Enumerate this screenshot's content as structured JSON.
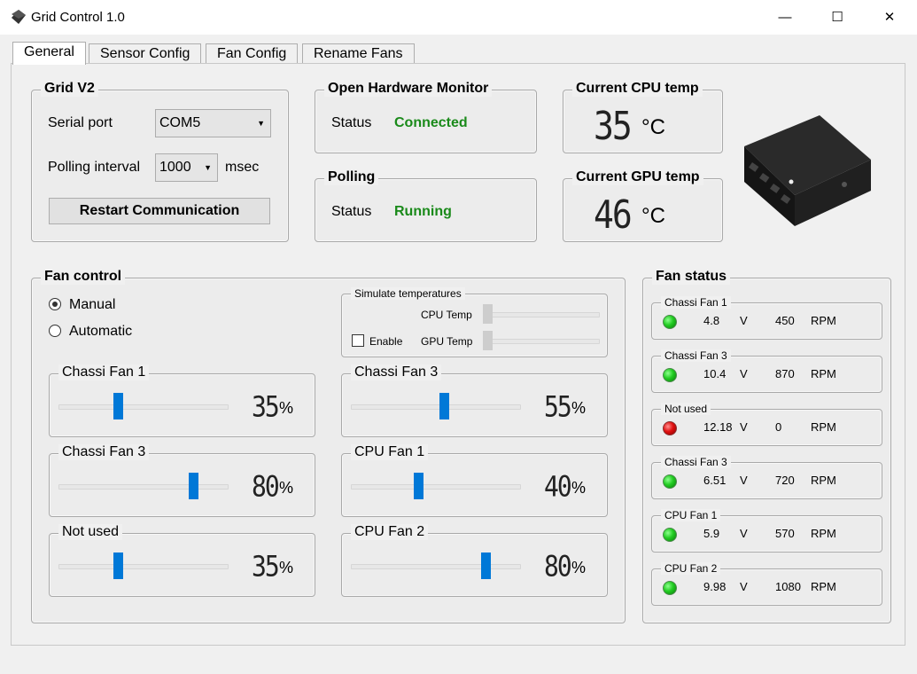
{
  "window": {
    "title": "Grid Control 1.0",
    "icon": "grid-device-icon",
    "minimize_glyph": "—",
    "maximize_glyph": "☐",
    "close_glyph": "✕"
  },
  "tabs": [
    {
      "label": "General",
      "selected": true
    },
    {
      "label": "Sensor Config",
      "selected": false
    },
    {
      "label": "Fan Config",
      "selected": false
    },
    {
      "label": "Rename Fans",
      "selected": false
    }
  ],
  "grid": {
    "title": "Grid V2",
    "serial_port_label": "Serial port",
    "serial_port_value": "COM5",
    "polling_interval_label": "Polling interval",
    "polling_interval_value": "1000",
    "polling_unit": "msec",
    "restart_button": "Restart Communication"
  },
  "ohm": {
    "title": "Open Hardware Monitor",
    "status_label": "Status",
    "status_value": "Connected"
  },
  "polling": {
    "title": "Polling",
    "status_label": "Status",
    "status_value": "Running"
  },
  "cpu_temp": {
    "title": "Current CPU temp",
    "value": "35",
    "unit": "°C"
  },
  "gpu_temp": {
    "title": "Current GPU temp",
    "value": "46",
    "unit": "°C"
  },
  "fan_control": {
    "title": "Fan control",
    "mode_manual": "Manual",
    "mode_automatic": "Automatic",
    "selected_mode": "Manual",
    "simulate": {
      "title": "Simulate temperatures",
      "cpu_label": "CPU Temp",
      "gpu_label": "GPU Temp",
      "enable_label": "Enable",
      "enabled": false
    },
    "fans": [
      {
        "name": "Chassi Fan 1",
        "value": "35",
        "unit": "%",
        "level": 0.35
      },
      {
        "name": "Chassi Fan 3",
        "value": "55",
        "unit": "%",
        "level": 0.55
      },
      {
        "name": "Chassi Fan 3",
        "value": "80",
        "unit": "%",
        "level": 0.8
      },
      {
        "name": "CPU Fan 1",
        "value": "40",
        "unit": "%",
        "level": 0.4
      },
      {
        "name": "Not used",
        "value": "35",
        "unit": "%",
        "level": 0.35
      },
      {
        "name": "CPU Fan 2",
        "value": "80",
        "unit": "%",
        "level": 0.8
      }
    ]
  },
  "fan_status": {
    "title": "Fan status",
    "voltage_unit": "V",
    "rpm_unit": "RPM",
    "items": [
      {
        "name": "Chassi Fan 1",
        "voltage": "4.8",
        "rpm": "450",
        "led": "green"
      },
      {
        "name": "Chassi Fan 3",
        "voltage": "10.4",
        "rpm": "870",
        "led": "green"
      },
      {
        "name": "Not used",
        "voltage": "12.18",
        "rpm": "0",
        "led": "red"
      },
      {
        "name": "Chassi Fan 3",
        "voltage": "6.51",
        "rpm": "720",
        "led": "green"
      },
      {
        "name": "CPU Fan 1",
        "voltage": "5.9",
        "rpm": "570",
        "led": "green"
      },
      {
        "name": "CPU Fan 2",
        "voltage": "9.98",
        "rpm": "1080",
        "led": "green"
      }
    ]
  },
  "colors": {
    "accent": "#0078d7",
    "status_green": "#1a8a1a",
    "led_green": "#22cc22",
    "led_red": "#e01010"
  }
}
